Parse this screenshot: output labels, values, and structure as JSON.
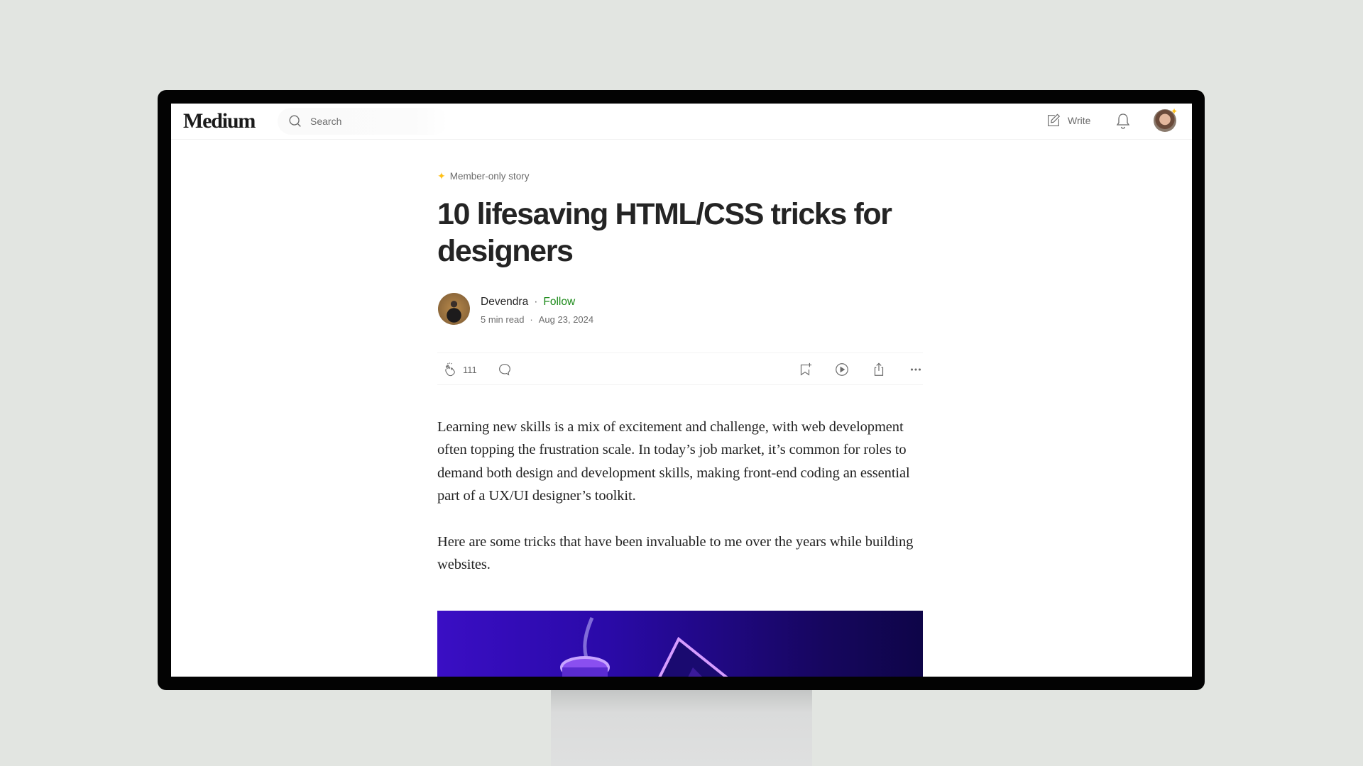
{
  "header": {
    "logo": "Medium",
    "search_placeholder": "Search",
    "write_label": "Write"
  },
  "article": {
    "badge": "Member-only story",
    "title": "10 lifesaving HTML/CSS tricks for designers",
    "author": {
      "name": "Devendra",
      "follow_label": "Follow",
      "separator": "·",
      "read_time": "5 min read",
      "date": "Aug 23, 2024"
    },
    "actions": {
      "clap_count": "111",
      "icons": [
        "clap-icon",
        "comment-icon",
        "bookmark-add-icon",
        "play-icon",
        "share-icon",
        "more-icon"
      ]
    },
    "paragraphs": [
      "Learning new skills is a mix of excitement and challenge, with web development often topping the frustration scale. In today’s job market, it’s common for roles to demand both design and development skills, making front-end coding an essential part of a UX/UI designer’s toolkit.",
      "Here are some tricks that have been invaluable to me over the years while building websites."
    ]
  },
  "colors": {
    "background": "#e2e5e1",
    "bezel": "#030303",
    "text_primary": "#242424",
    "text_secondary": "#6b6b6b",
    "follow_green": "#1a8917",
    "member_star": "#ffc017",
    "hero_blue": "#2a0aa8"
  }
}
